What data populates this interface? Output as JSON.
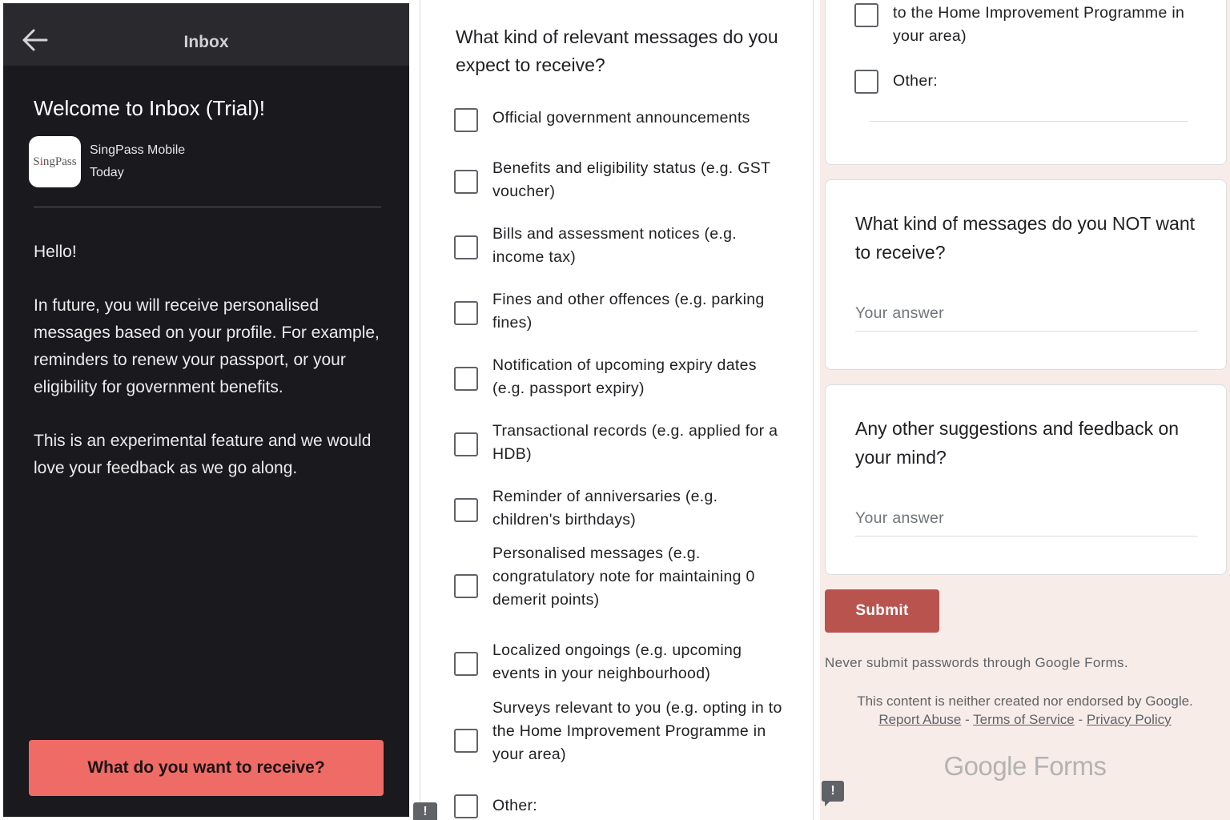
{
  "inbox": {
    "header_title": "Inbox",
    "welcome_title": "Welcome to Inbox (Trial)!",
    "logo_text_a": "S",
    "logo_text_i": "i",
    "logo_text_b": "ngPass",
    "app_name": "SingPass Mobile",
    "date": "Today",
    "hello": "Hello!",
    "paragraph1": "In future, you will receive personalised messages based on your profile. For example, reminders to renew your passport, or your eligibility for government benefits.",
    "paragraph2": "This is an experimental feature and we would love your feedback as we go along.",
    "cta_label": "What do you want to receive?"
  },
  "form": {
    "question1": "What kind of relevant messages do you expect to receive?",
    "options": [
      "Official government announcements",
      "Benefits and eligibility status (e.g. GST voucher)",
      "Bills and assessment notices (e.g. income tax)",
      "Fines and other offences (e.g. parking fines)",
      "Notification of upcoming expiry dates (e.g. passport expiry)",
      "Transactional records (e.g. applied for a HDB)",
      "Reminder of anniversaries (e.g. children's birthdays)",
      "Personalised messages (e.g. congratulatory note for maintaining 0 demerit points)",
      "Localized ongoings (e.g. upcoming events in your neighbourhood)",
      "Surveys relevant to you (e.g. opting in to the Home Improvement Programme in your area)",
      "Other:"
    ],
    "continued_option_tail": "to the Home Improvement Programme in your area)",
    "other_label": "Other:",
    "question2": "What kind of messages do you NOT want to receive?",
    "question3": "Any other suggestions and feedback on your mind?",
    "answer_placeholder": "Your answer",
    "submit_label": "Submit",
    "never_submit": "Never submit passwords through Google Forms.",
    "disclaimer": "This content is neither created nor endorsed by Google.",
    "links": {
      "report_abuse": "Report Abuse",
      "separator": " - ",
      "terms": "Terms of Service",
      "privacy": "Privacy Policy"
    },
    "brand_google": "Google",
    "brand_forms": "Forms",
    "feedback_glyph": "!"
  }
}
